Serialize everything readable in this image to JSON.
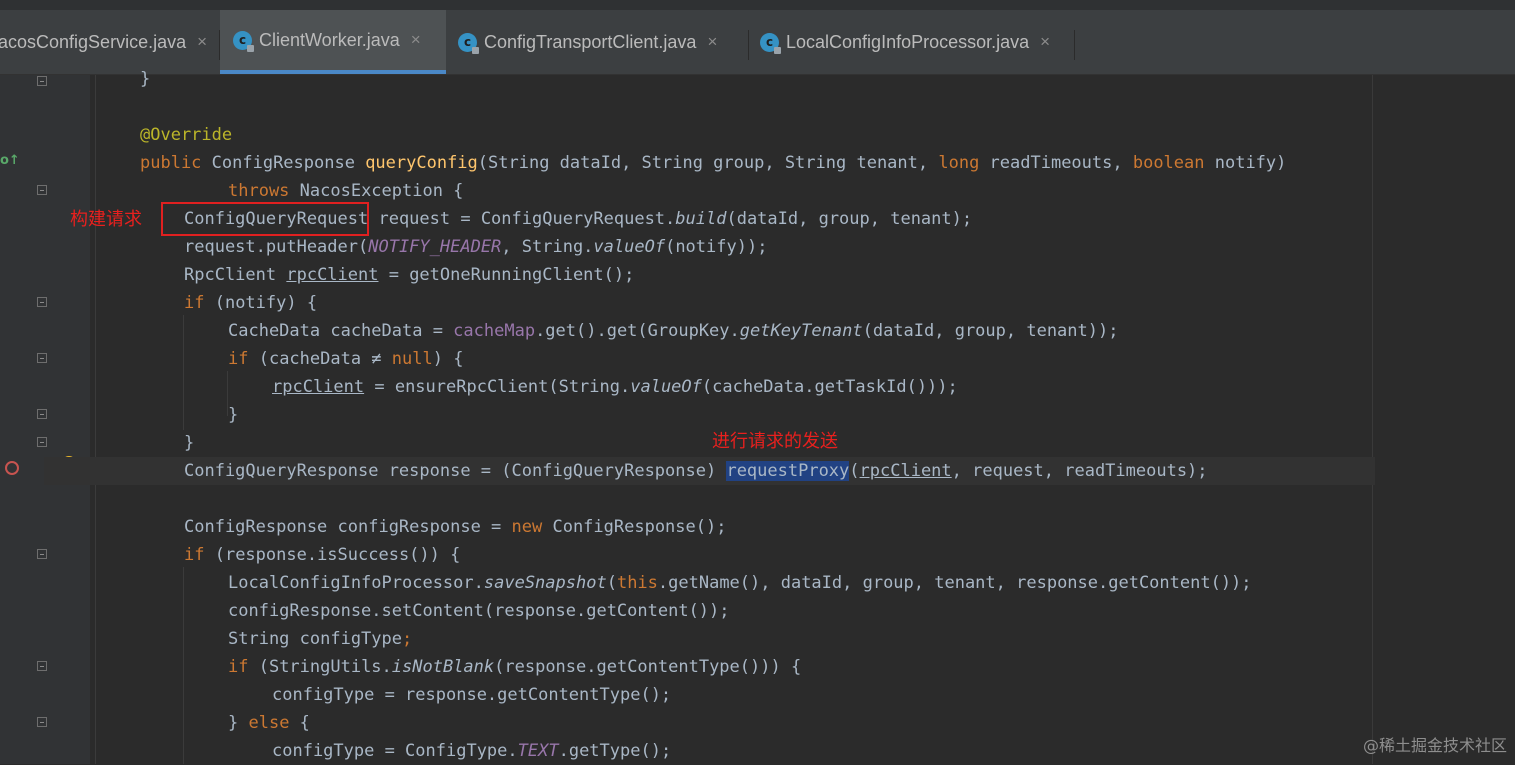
{
  "tabs": [
    {
      "label": "acosConfigService.java",
      "active": false
    },
    {
      "label": "ClientWorker.java",
      "active": true
    },
    {
      "label": "ConfigTransportClient.java",
      "active": false
    },
    {
      "label": "LocalConfigInfoProcessor.java",
      "active": false
    }
  ],
  "tab_close_glyph": "×",
  "file_icon_letter": "c",
  "annotations": {
    "build_request": "构建请求",
    "send_request": "进行请求的发送"
  },
  "watermark": "@稀土掘金技术社区",
  "colors": {
    "background": "#2b2b2b",
    "keyword": "#cc7832",
    "method": "#ffc66d",
    "field": "#9876aa",
    "annotation_mark": "#e02020",
    "selection": "#214283"
  },
  "code": {
    "l0": "}",
    "l2": "@Override",
    "l3": {
      "a": "public ",
      "b": "ConfigResponse ",
      "c": "queryConfig",
      "d": "(String dataId, String group, String tenant, ",
      "e": "long ",
      "f": "readTimeouts, ",
      "g": "boolean ",
      "h": "notify)"
    },
    "l4": {
      "a": "throws ",
      "b": "NacosException {"
    },
    "l5": {
      "a": "ConfigQueryRequest ",
      "b": "request = ConfigQueryRequest.",
      "c": "build",
      "d": "(dataId, group, tenant);"
    },
    "l6": {
      "a": "request.putHeader(",
      "b": "NOTIFY_HEADER",
      "c": ", String.",
      "d": "valueOf",
      "e": "(notify));"
    },
    "l7": {
      "a": "RpcClient ",
      "b": "rpcClient",
      "c": " = getOneRunningClient();"
    },
    "l8": {
      "a": "if ",
      "b": "(notify) {"
    },
    "l9": {
      "a": "CacheData cacheData = ",
      "b": "cacheMap",
      "c": ".get().get(GroupKey.",
      "d": "getKeyTenant",
      "e": "(dataId, group, tenant));"
    },
    "l10": {
      "a": "if ",
      "b": "(cacheData ≠ ",
      "c": "null",
      "d": ") {"
    },
    "l11": {
      "a": "rpcClient",
      "b": " = ensureRpcClient(String.",
      "c": "valueOf",
      "d": "(cacheData.getTaskId()));"
    },
    "l12": "}",
    "l13": "}",
    "l14": {
      "a": "ConfigQueryResponse response = (ConfigQueryResponse) ",
      "b": "requestProxy",
      "c": "(",
      "d": "rpcClient",
      "e": ", request, readTimeouts);"
    },
    "l16": {
      "a": "ConfigResponse configResponse = ",
      "b": "new ",
      "c": "ConfigResponse();"
    },
    "l17": {
      "a": "if ",
      "b": "(response.isSuccess()) {"
    },
    "l18": {
      "a": "LocalConfigInfoProcessor.",
      "b": "saveSnapshot",
      "c": "(",
      "d": "this",
      "e": ".getName(), dataId, group, tenant, response.getContent());"
    },
    "l19": "configResponse.setContent(response.getContent());",
    "l20": {
      "a": "String configType",
      "b": ";"
    },
    "l21": {
      "a": "if ",
      "b": "(StringUtils.",
      "c": "isNotBlank",
      "d": "(response.getContentType())) {"
    },
    "l22": "configType = response.getContentType();",
    "l23": {
      "a": "} ",
      "b": "else ",
      "c": "{"
    },
    "l24": {
      "a": "configType = ConfigType.",
      "b": "TEXT",
      "c": ".getType();"
    }
  }
}
